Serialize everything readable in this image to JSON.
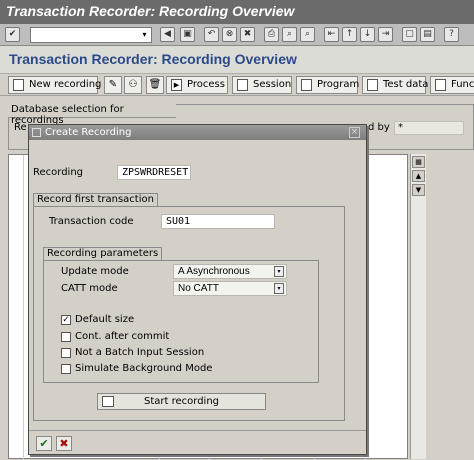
{
  "window": {
    "title": "Transaction Recorder: Recording Overview"
  },
  "page": {
    "title": "Transaction Recorder: Recording Overview"
  },
  "app_toolbar": {
    "new_recording": "New recording",
    "process": "Process",
    "session": "Session",
    "program": "Program",
    "test_data": "Test data",
    "function_module": "Funct"
  },
  "background": {
    "frame_title": "Database selection for recordings",
    "label_left": "Re",
    "label_right": "d by",
    "star_value": "*"
  },
  "dialog": {
    "title": "Create Recording",
    "recording_label": "Recording",
    "recording_value": "ZPSWRDRESET",
    "first_tx_group": "Record first transaction",
    "tcode_label": "Transaction code",
    "tcode_value": "SU01",
    "params_group": "Recording parameters",
    "update_mode_label": "Update mode",
    "update_mode_value": "A Asynchronous",
    "catt_mode_label": "CATT mode",
    "catt_mode_value": "No CATT",
    "checkboxes": [
      {
        "label": "Default size",
        "checked": true
      },
      {
        "label": "Cont. after commit",
        "checked": false
      },
      {
        "label": "Not a Batch Input Session",
        "checked": false
      },
      {
        "label": "Simulate Background Mode",
        "checked": false
      }
    ],
    "start_button": "Start recording"
  },
  "icons": {
    "enter": "check-icon",
    "cancel": "x-icon"
  }
}
